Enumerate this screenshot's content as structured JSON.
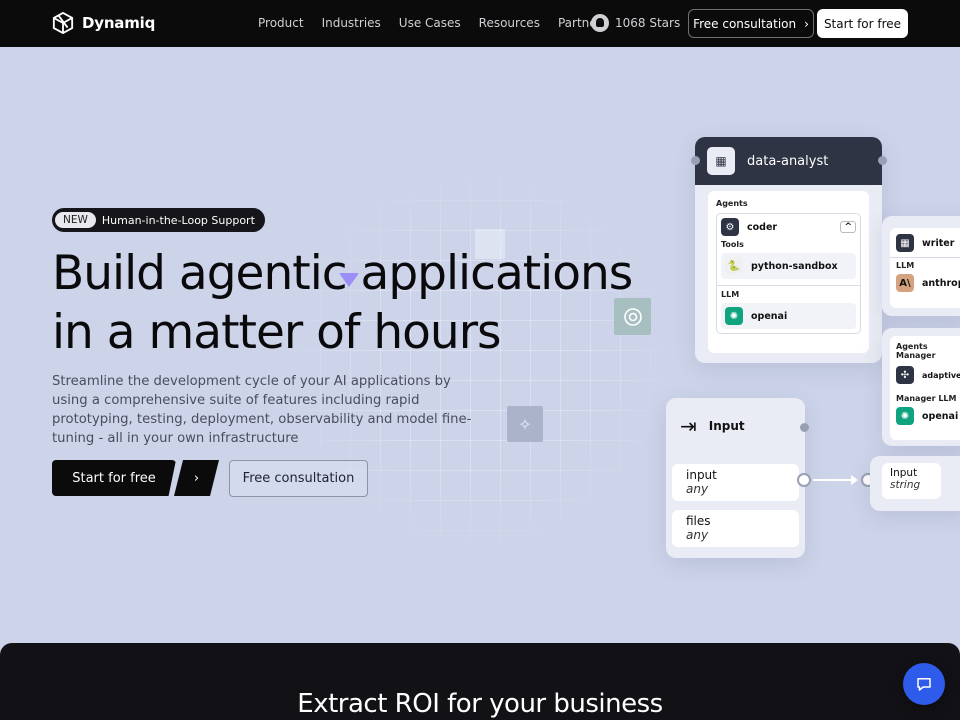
{
  "nav": {
    "brand": "Dynamiq",
    "links": [
      "Product",
      "Industries",
      "Use Cases",
      "Resources",
      "Partners"
    ],
    "stars": "1068 Stars",
    "consult_label": "Free consultation",
    "start_label": "Start for free"
  },
  "hero": {
    "badge_new": "NEW",
    "badge_text": "Human-in-the-Loop Support",
    "headline_line1": "Build agentic applications",
    "headline_line2": "in a matter of hours",
    "subtitle": "Streamline the development cycle of your AI applications by using a comprehensive suite of features including rapid prototyping, testing, deployment, observability and model fine-tuning - all in your own infrastructure",
    "start_label": "Start for free",
    "arrow": "›",
    "consult_label": "Free consultation"
  },
  "diagram": {
    "analyst": {
      "title": "data-analyst",
      "agents_label": "Agents",
      "agent": "coder",
      "tools_label": "Tools",
      "tool": "python-sandbox",
      "llm_label": "LLM",
      "llm": "openai"
    },
    "writer": {
      "title": "writer",
      "llm_label": "LLM",
      "llm": "anthrop"
    },
    "manager": {
      "agents_manager_label": "Agents Manager",
      "agents_manager": "adaptive",
      "manager_llm_label": "Manager LLM",
      "manager_llm": "openai"
    },
    "input_node": {
      "title": "Input",
      "ports": [
        {
          "name": "input",
          "type": "any"
        },
        {
          "name": "files",
          "type": "any"
        }
      ]
    },
    "target_port": {
      "name": "Input",
      "type": "string"
    }
  },
  "bottom": {
    "title": "Extract ROI for your business"
  },
  "colors": {
    "hero_bg": "#cdd4ea",
    "nav_bg": "#0b0b0c",
    "card_header": "#2f3444",
    "chat_blue": "#2f5bea"
  }
}
